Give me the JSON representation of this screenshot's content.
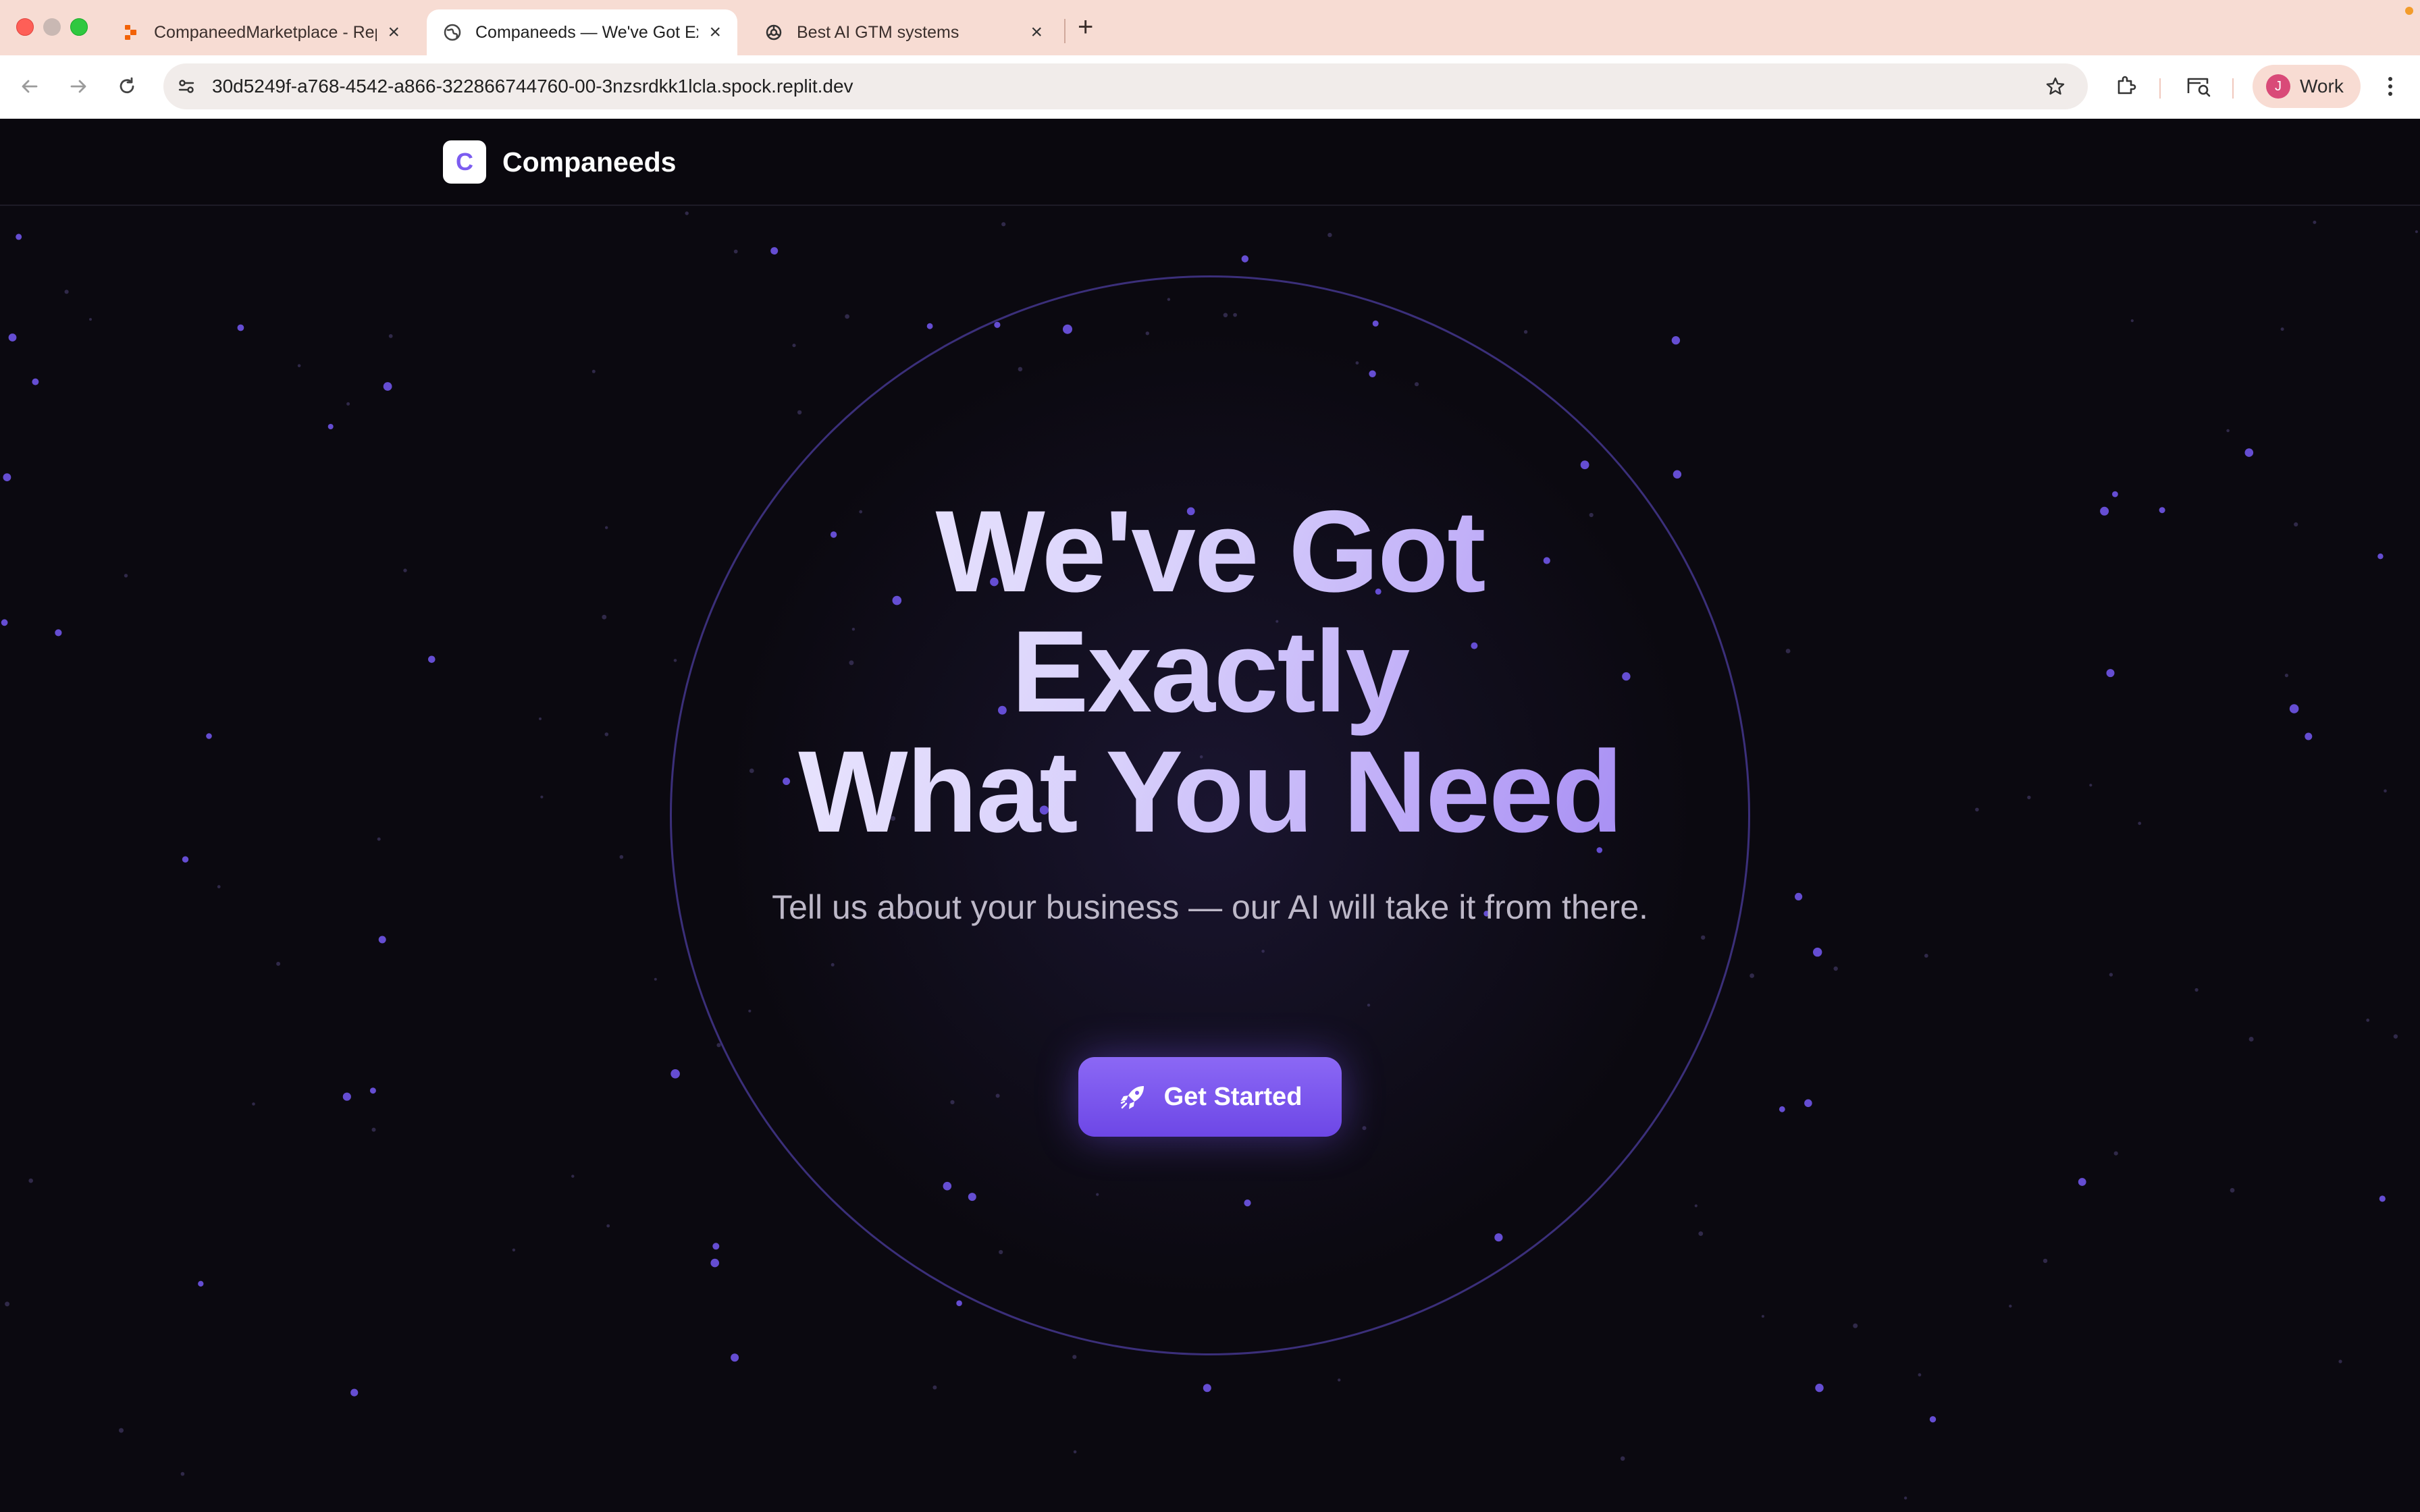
{
  "browser": {
    "tabs": [
      {
        "title": "CompaneedMarketplace - Replit",
        "favicon": "replit-icon",
        "active": false
      },
      {
        "title": "Companeeds — We've Got Exactly What You Need",
        "favicon": "globe-icon",
        "active": true
      },
      {
        "title": "Best AI GTM systems",
        "favicon": "openai-icon",
        "active": false
      }
    ],
    "url": "30d5249f-a768-4542-a866-322866744760-00-3nzsrdkk1lcla.spock.replit.dev",
    "profile": {
      "initial": "J",
      "name": "Work"
    }
  },
  "site": {
    "logo_letter": "C",
    "brand": "Companeeds"
  },
  "hero": {
    "title_line1": "We've Got",
    "title_line2": "Exactly",
    "title_line3": "What You Need",
    "subtitle": "Tell us about your business — our AI will take it from there.",
    "cta_label": "Get Started",
    "cta_icon": "rocket-icon"
  },
  "colors": {
    "accent": "#7c5cf0",
    "background": "#0b0910",
    "ring": "#3b2f7a"
  }
}
